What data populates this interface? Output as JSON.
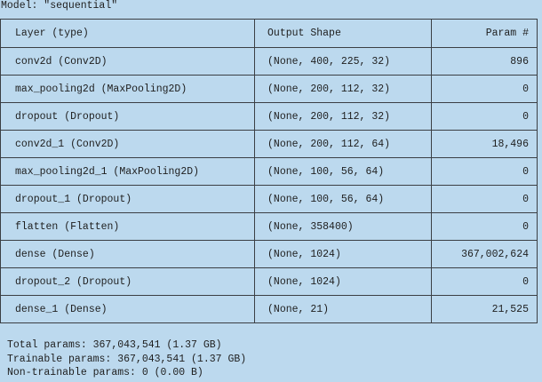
{
  "model": {
    "title": "Model: \"sequential\""
  },
  "table": {
    "headers": {
      "layer": "Layer (type)",
      "shape": "Output Shape",
      "params": "Param #"
    },
    "rows": [
      {
        "layer": "conv2d (Conv2D)",
        "shape": "(None, 400, 225, 32)",
        "params": "896"
      },
      {
        "layer": "max_pooling2d (MaxPooling2D)",
        "shape": "(None, 200, 112, 32)",
        "params": "0"
      },
      {
        "layer": "dropout (Dropout)",
        "shape": "(None, 200, 112, 32)",
        "params": "0"
      },
      {
        "layer": "conv2d_1 (Conv2D)",
        "shape": "(None, 200, 112, 64)",
        "params": "18,496"
      },
      {
        "layer": "max_pooling2d_1 (MaxPooling2D)",
        "shape": "(None, 100, 56, 64)",
        "params": "0"
      },
      {
        "layer": "dropout_1 (Dropout)",
        "shape": "(None, 100, 56, 64)",
        "params": "0"
      },
      {
        "layer": "flatten (Flatten)",
        "shape": "(None, 358400)",
        "params": "0"
      },
      {
        "layer": "dense (Dense)",
        "shape": "(None, 1024)",
        "params": "367,002,624"
      },
      {
        "layer": "dropout_2 (Dropout)",
        "shape": "(None, 1024)",
        "params": "0"
      },
      {
        "layer": "dense_1 (Dense)",
        "shape": "(None, 21)",
        "params": "21,525"
      }
    ]
  },
  "totals": {
    "total": "Total params: 367,043,541 (1.37 GB)",
    "trainable": "Trainable params: 367,043,541 (1.37 GB)",
    "non_trainable": "Non-trainable params: 0 (0.00 B)"
  },
  "colors": {
    "background": "#bcd9ee",
    "border": "#3b3f44",
    "text": "#1e1e1e"
  }
}
